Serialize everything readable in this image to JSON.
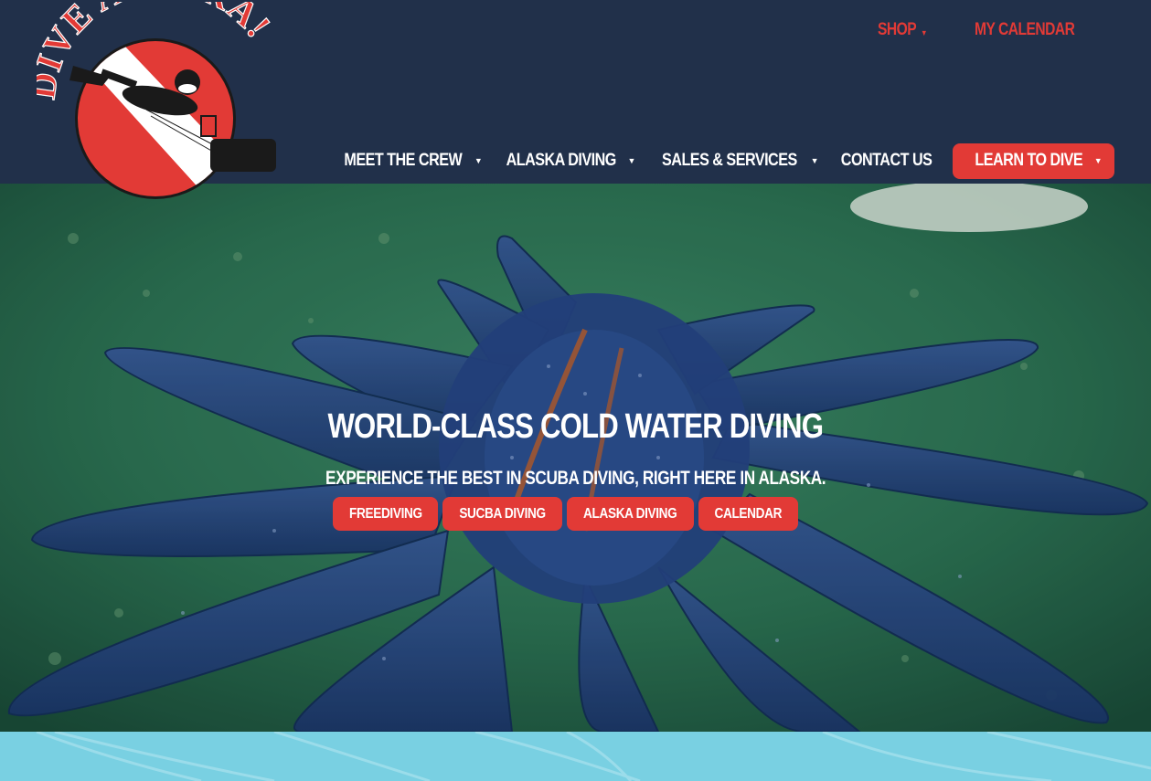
{
  "brand": {
    "logo_text": "DIVE ALASKA!",
    "accent": "#e23a36",
    "navy": "#21304a"
  },
  "topnav": {
    "shop": "SHOP",
    "calendar": "MY CALENDAR"
  },
  "mainnav": [
    {
      "label": "MEET THE CREW",
      "caret": "▾"
    },
    {
      "label": "ALASKA DIVING",
      "caret": "▾"
    },
    {
      "label": "SALES & SERVICES",
      "caret": "▾"
    },
    {
      "label": "CONTACT US"
    },
    {
      "label": "LEARN TO DIVE",
      "caret": "▾"
    }
  ],
  "hero": {
    "title": "WORLD-CLASS COLD WATER DIVING",
    "subtitle": "EXPERIENCE THE BEST IN SCUBA DIVING, RIGHT HERE IN ALASKA.",
    "buttons": [
      "FREEDIVING",
      "SUCBA DIVING",
      "ALASKA DIVING",
      "CALENDAR"
    ]
  }
}
